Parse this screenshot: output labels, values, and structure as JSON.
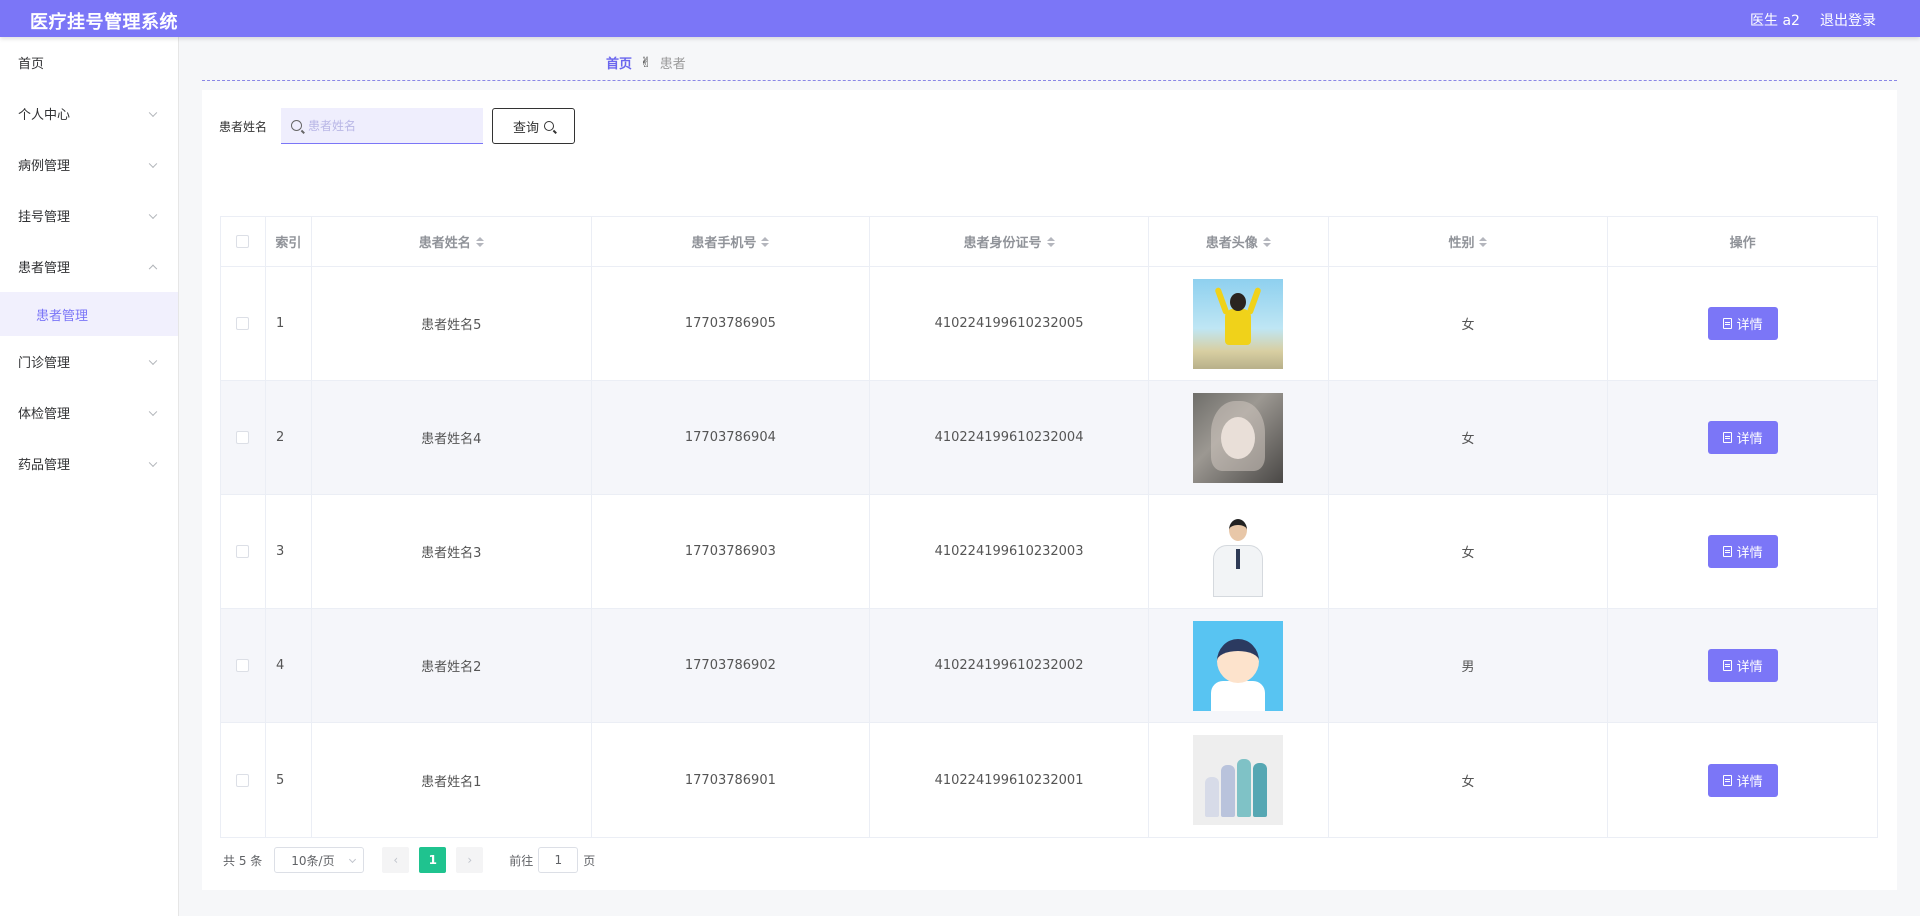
{
  "header": {
    "app_title": "医疗挂号管理系统",
    "user": "医生 a2",
    "logout": "退出登录",
    "brand_color": "#7b76f7"
  },
  "sidebar": {
    "items": [
      {
        "label": "首页"
      },
      {
        "label": "个人中心"
      },
      {
        "label": "病例管理"
      },
      {
        "label": "挂号管理"
      },
      {
        "label": "患者管理",
        "expanded": true
      },
      {
        "label": "门诊管理"
      },
      {
        "label": "体检管理"
      },
      {
        "label": "药品管理"
      }
    ],
    "active_sub": "患者管理"
  },
  "breadcrumb": {
    "home": "首页",
    "separator_icon": "hand-icon",
    "current": "患者"
  },
  "search": {
    "label": "患者姓名",
    "placeholder": "患者姓名",
    "value": "",
    "button": "查询"
  },
  "table": {
    "columns": [
      "索引",
      "患者姓名",
      "患者手机号",
      "患者身份证号",
      "患者头像",
      "性别",
      "操作"
    ],
    "sortable": [
      false,
      true,
      true,
      true,
      true,
      true,
      false
    ],
    "action_label": "详情",
    "rows": [
      {
        "index": "1",
        "name": "患者姓名5",
        "phone": "17703786905",
        "id_number": "410224199610232005",
        "gender": "女"
      },
      {
        "index": "2",
        "name": "患者姓名4",
        "phone": "17703786904",
        "id_number": "410224199610232004",
        "gender": "女"
      },
      {
        "index": "3",
        "name": "患者姓名3",
        "phone": "17703786903",
        "id_number": "410224199610232003",
        "gender": "女"
      },
      {
        "index": "4",
        "name": "患者姓名2",
        "phone": "17703786902",
        "id_number": "410224199610232002",
        "gender": "男"
      },
      {
        "index": "5",
        "name": "患者姓名1",
        "phone": "17703786901",
        "id_number": "410224199610232001",
        "gender": "女"
      }
    ]
  },
  "pagination": {
    "total": "共 5 条",
    "page_size": "10条/页",
    "current_page": "1",
    "goto_label": "前往",
    "goto_value": "1",
    "page_suffix": "页",
    "active_color": "#1fc38f"
  }
}
